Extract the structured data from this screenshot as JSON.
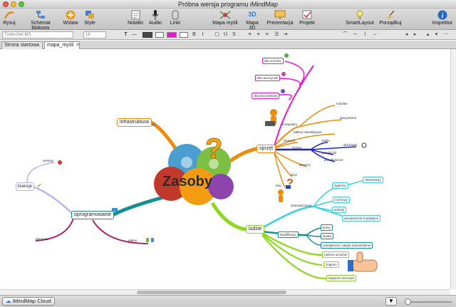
{
  "window": {
    "title": "Próbna wersja programu iMindMap"
  },
  "toolbar": {
    "rysuj": "Rysuj",
    "schemat": "Schemat blokowy",
    "wstaw": "Wstaw",
    "style": "Style",
    "notatki": "Notatki",
    "audio": "Audio",
    "linki": "Linki",
    "mapa_mysli": "Mapa myśli",
    "mapa_3d": "Mapa 3D",
    "prezentacja": "Prezentacja",
    "projekt": "Projekt",
    "smartlayout": "SmartLayout",
    "porzadkuj": "Porządkuj",
    "inspektor": "Inspektor"
  },
  "format": {
    "font": "Trebuchet MS",
    "size": "18"
  },
  "tabs": [
    {
      "label": "Strona startowa"
    },
    {
      "label": "mapa_myśli"
    }
  ],
  "map": {
    "central": "Zasoby",
    "infrastruktura": "infrastruktura",
    "sprzet": "sprzęt",
    "ludzie": "ludzie",
    "oprogramowanie": "oprogramowanie",
    "licencje": "licencje",
    "sprzet_branches": {
      "dla_uczniow": "dla uczniów",
      "dla_nauczycieli": "dla nauczycieli",
      "dla_pracownikow": "dla pracowników",
      "komputery": "komputery",
      "mobilne": "mobilne",
      "stacjonarne": "stacjonarne",
      "tablice": "tablice interaktywne",
      "drukarki": "drukarki",
      "drobny": "drobny",
      "kable": "kable",
      "sluchawki": "słuchawki",
      "przelaczki": "przełączki",
      "przedluzacze": "przedłużacze",
      "skanery": "skanery",
      "sieci": "sieci",
      "foto": "foto"
    },
    "ludzie_branches": {
      "doswiadczenie": "doświadczenie",
      "dyplomy": "dyplomy",
      "obserwacja": "obserwacja",
      "rozmowy": "rozmowy",
      "ankiety": "ankiety",
      "sprawdzenie": "sprawdzenie w praktyce",
      "kwalifikacje": "kwalifikacje",
      "kursy": "kursy",
      "studia": "studia",
      "umiejetnosci": "umiejętności nabyte samodzielnie",
      "rodzice": "rodzice uczniów",
      "znajomi": "znajomi",
      "wsparcie": "wsparcie domowe"
    },
    "oprog_branches": {
      "serwisy": "serwisy",
      "darmowe": "darmowe",
      "platne": "płatne"
    }
  },
  "status": {
    "cloud_button": "iMindMap Cloud"
  },
  "colors": {
    "pink": "#e619d4",
    "orange": "#f08a0c",
    "blue": "#1f22d6",
    "cyan": "#35d1e0",
    "teal": "#138f95",
    "green": "#8ed81f",
    "lavender": "#b9b2f0",
    "magenta": "#b1125c"
  }
}
